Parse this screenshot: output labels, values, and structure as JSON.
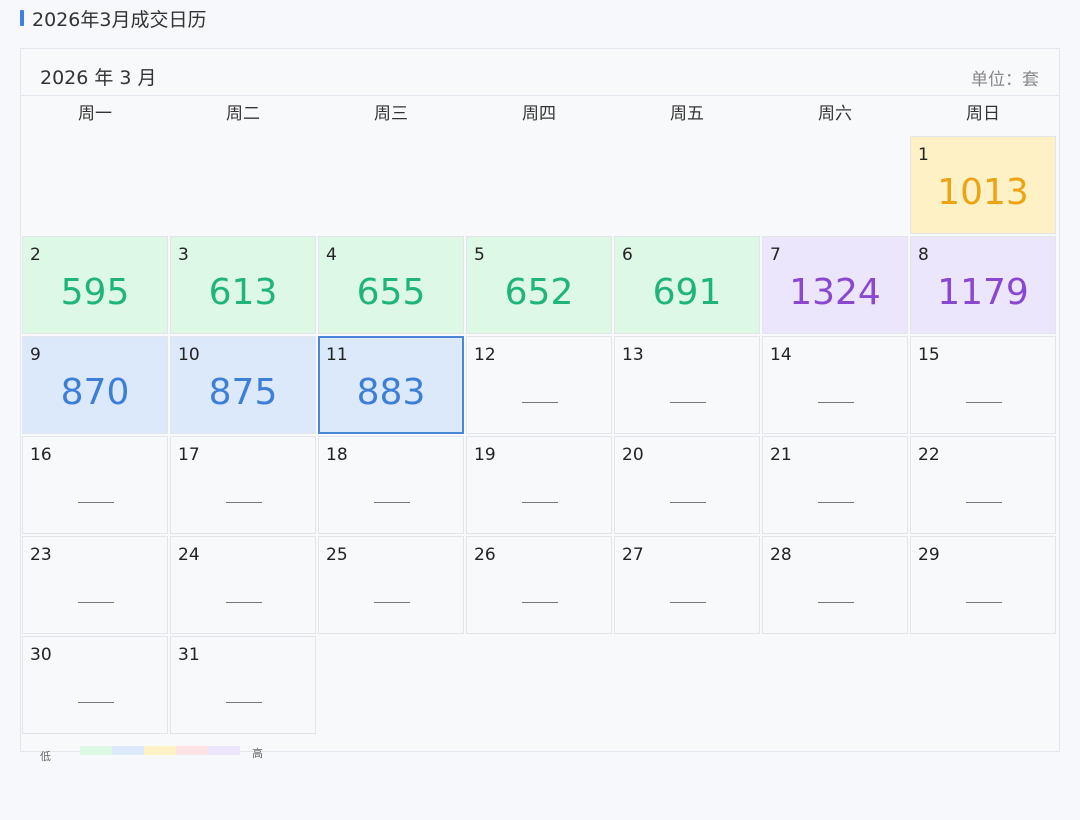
{
  "page": {
    "title": "2026年3月成交日历"
  },
  "calendar": {
    "month_label": "2026 年 3 月",
    "unit_label": "单位：套",
    "weekdays": [
      "周一",
      "周二",
      "周三",
      "周四",
      "周五",
      "周六",
      "周日"
    ],
    "first_weekday_col": 6,
    "days_in_month": 31,
    "empty_value_symbol": "—",
    "selected_day": 11,
    "values": {
      "1": {
        "value": "1013",
        "level": "yellow"
      },
      "2": {
        "value": "595",
        "level": "green"
      },
      "3": {
        "value": "613",
        "level": "green"
      },
      "4": {
        "value": "655",
        "level": "green"
      },
      "5": {
        "value": "652",
        "level": "green"
      },
      "6": {
        "value": "691",
        "level": "green"
      },
      "7": {
        "value": "1324",
        "level": "purple"
      },
      "8": {
        "value": "1179",
        "level": "purple"
      },
      "9": {
        "value": "870",
        "level": "blue"
      },
      "10": {
        "value": "875",
        "level": "blue"
      },
      "11": {
        "value": "883",
        "level": "blue"
      }
    }
  },
  "legend": {
    "low_label": "低",
    "high_label": "高",
    "colors": [
      "#ddf8e5",
      "#dce9fb",
      "#fdf1c5",
      "#fde3e6",
      "#ece6fc"
    ]
  }
}
